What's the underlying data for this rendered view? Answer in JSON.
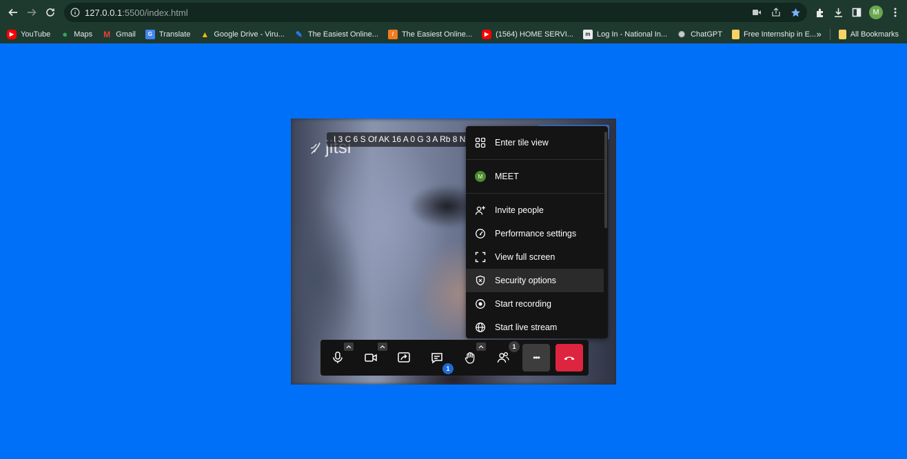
{
  "browser": {
    "url_host": "127.0.0.1",
    "url_path": ":5500/index.html",
    "profile_initial": "M",
    "bookmarks": [
      {
        "label": "YouTube",
        "icon": "youtube-icon",
        "color": "#ff0000"
      },
      {
        "label": "Maps",
        "icon": "maps-icon",
        "color": "#34a853"
      },
      {
        "label": "Gmail",
        "icon": "gmail-icon",
        "color": "#ea4335"
      },
      {
        "label": "Translate",
        "icon": "translate-icon",
        "color": "#4285f4"
      },
      {
        "label": "Google Drive - Viru...",
        "icon": "drive-icon",
        "color": "#fbbc04"
      },
      {
        "label": "The Easiest Online...",
        "icon": "pen-icon",
        "color": "#2a7fff"
      },
      {
        "label": "The Easiest Online...",
        "icon": "app-icon",
        "color": "#f47b20"
      },
      {
        "label": "(1564) HOME SERVI...",
        "icon": "youtube-icon",
        "color": "#ff0000"
      },
      {
        "label": "Log In - National In...",
        "icon": "building-icon",
        "color": "#e8eaed"
      },
      {
        "label": "ChatGPT",
        "icon": "chatgpt-icon",
        "color": "#10a37f"
      },
      {
        "label": "Free Internship in E...",
        "icon": "bookmark-icon",
        "color": "#f9d266"
      }
    ],
    "overflow_label": "»",
    "all_bookmarks_label": "All Bookmarks"
  },
  "meeting": {
    "logo_text": "jitsi",
    "room_name": "I 3 C 6 S Of AK 16 A 0 G 3 A Rb 8 N",
    "menu": {
      "tile_view": "Enter tile view",
      "participant_initial": "M",
      "participant_name": "MEET",
      "invite": "Invite people",
      "performance": "Performance settings",
      "fullscreen": "View full screen",
      "security": "Security options",
      "recording": "Start recording",
      "live_stream": "Start live stream"
    },
    "toolbar": {
      "chat_badge": "1",
      "participants_badge": "1",
      "more_label": "•••"
    },
    "colors": {
      "hangup": "#dd2540",
      "chat_badge": "#1f6bd6",
      "background": "#0070f8"
    }
  }
}
